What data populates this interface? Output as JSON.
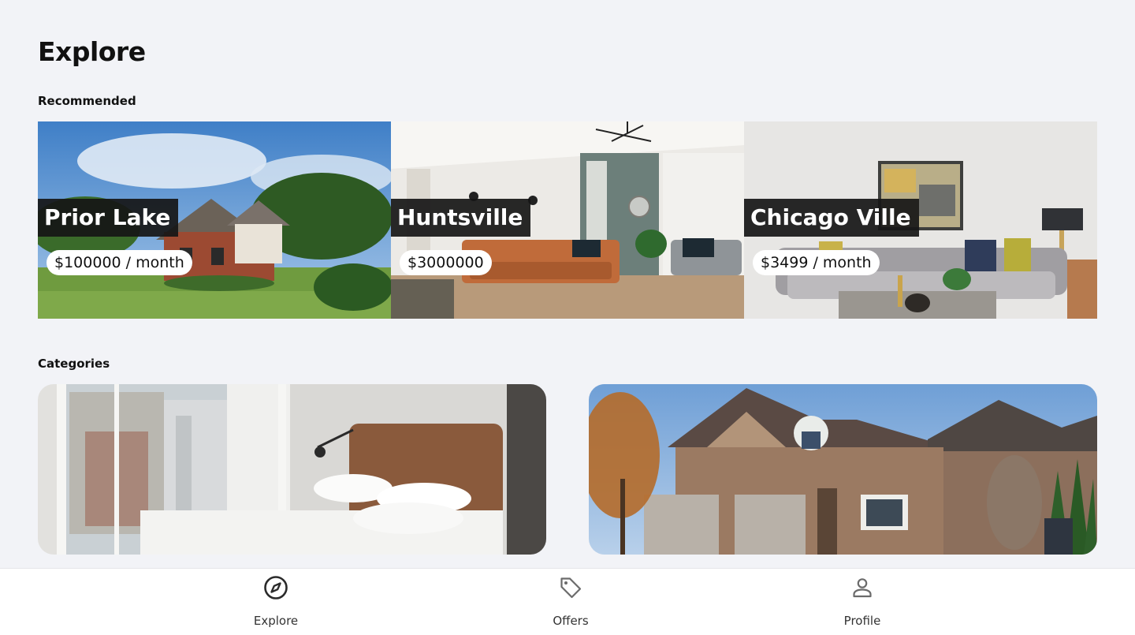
{
  "page": {
    "title": "Explore"
  },
  "recommended": {
    "label": "Recommended",
    "items": [
      {
        "name": "Prior Lake",
        "price": "$100000 / month"
      },
      {
        "name": "Huntsville",
        "price": "$3000000"
      },
      {
        "name": "Chicago Ville",
        "price": "$3499 / month"
      }
    ]
  },
  "categories": {
    "label": "Categories",
    "items": [
      {
        "image": "bedroom-photo"
      },
      {
        "image": "house-exterior-photo"
      }
    ]
  },
  "bottom_nav": {
    "items": [
      {
        "label": "Explore",
        "icon": "compass-icon",
        "active": true
      },
      {
        "label": "Offers",
        "icon": "tag-icon",
        "active": false
      },
      {
        "label": "Profile",
        "icon": "user-icon",
        "active": false
      }
    ]
  },
  "colors": {
    "background": "#f2f3f7",
    "nav_background": "#ffffff",
    "label_background": "#161616",
    "price_pill": "#ffffff"
  }
}
